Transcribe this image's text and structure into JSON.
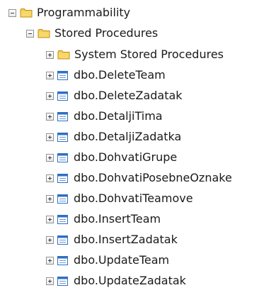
{
  "tree": {
    "root": {
      "label": "Programmability",
      "icon": "folder-icon",
      "state": "expanded"
    },
    "child": {
      "label": "Stored Procedures",
      "icon": "folder-icon",
      "state": "expanded"
    },
    "items": [
      {
        "label": "System Stored Procedures",
        "icon": "folder-icon",
        "state": "collapsed"
      },
      {
        "label": "dbo.DeleteTeam",
        "icon": "stored-procedure-icon",
        "state": "collapsed"
      },
      {
        "label": "dbo.DeleteZadatak",
        "icon": "stored-procedure-icon",
        "state": "collapsed"
      },
      {
        "label": "dbo.DetaljiTima",
        "icon": "stored-procedure-icon",
        "state": "collapsed"
      },
      {
        "label": "dbo.DetaljiZadatka",
        "icon": "stored-procedure-icon",
        "state": "collapsed"
      },
      {
        "label": "dbo.DohvatiGrupe",
        "icon": "stored-procedure-icon",
        "state": "collapsed"
      },
      {
        "label": "dbo.DohvatiPosebneOznake",
        "icon": "stored-procedure-icon",
        "state": "collapsed"
      },
      {
        "label": "dbo.DohvatiTeamove",
        "icon": "stored-procedure-icon",
        "state": "collapsed"
      },
      {
        "label": "dbo.InsertTeam",
        "icon": "stored-procedure-icon",
        "state": "collapsed"
      },
      {
        "label": "dbo.InsertZadatak",
        "icon": "stored-procedure-icon",
        "state": "collapsed"
      },
      {
        "label": "dbo.UpdateTeam",
        "icon": "stored-procedure-icon",
        "state": "collapsed"
      },
      {
        "label": "dbo.UpdateZadatak",
        "icon": "stored-procedure-icon",
        "state": "collapsed"
      }
    ]
  },
  "colors": {
    "folder": "#e8b830",
    "folder_dark": "#c48a12",
    "procedure": "#2f6fc4",
    "text": "#1a1a1a"
  }
}
